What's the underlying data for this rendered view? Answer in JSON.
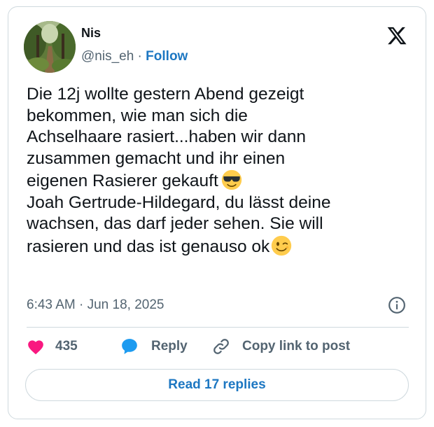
{
  "author": {
    "display_name": "Nis",
    "handle": "@nis_eh",
    "separator": " · ",
    "follow_label": "Follow",
    "avatar_icon": "forest-path-avatar"
  },
  "platform_icon": "x-logo-icon",
  "tweet": {
    "lines": [
      "Die 12j wollte gestern Abend gezeigt",
      "bekommen, wie man sich die",
      "Achselhaare rasiert...haben wir dann",
      "zusammen gemacht und ihr einen",
      "eigenen Rasierer gekauft",
      "Joah Gertrude-Hildegard, du lässt deine",
      "wachsen, das darf jeder sehen. Sie will",
      "rasieren und das ist genauso ok"
    ],
    "emojis": [
      "smiling-face-with-sunglasses",
      "winking-face"
    ]
  },
  "meta": {
    "timestamp": "6:43 AM · Jun 18, 2025"
  },
  "actions": {
    "like_count": "435",
    "reply_label": "Reply",
    "copy_link_label": "Copy link to post"
  },
  "read_replies_label": "Read 17 replies",
  "colors": {
    "accent_blue": "#1d77c2",
    "heart_pink": "#f91880",
    "muted_gray": "#536471",
    "border": "#cfd9de"
  }
}
